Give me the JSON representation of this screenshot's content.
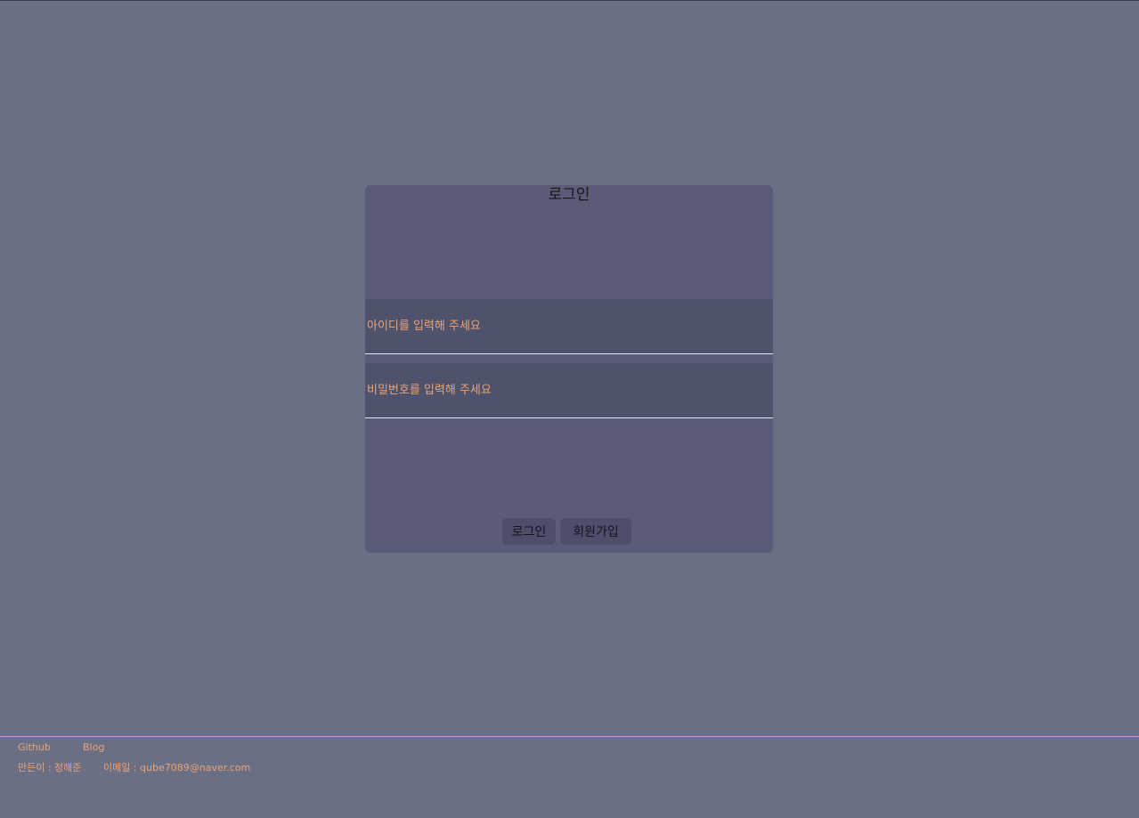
{
  "login": {
    "title": "로그인",
    "id_placeholder": "아이디를 입력해 주세요",
    "password_placeholder": "비밀번호를 입력해 주세요",
    "login_button": "로그인",
    "signup_button": "회원가입"
  },
  "footer": {
    "github_link": "Github",
    "blog_link": "Blog",
    "author": "만든이 : 정해준",
    "email": "이메일 : qube7089@naver.com"
  },
  "colors": {
    "background": "#6b6f83",
    "card": "#5a5b76",
    "input": "#4f526b",
    "accent": "#e9a47a"
  }
}
